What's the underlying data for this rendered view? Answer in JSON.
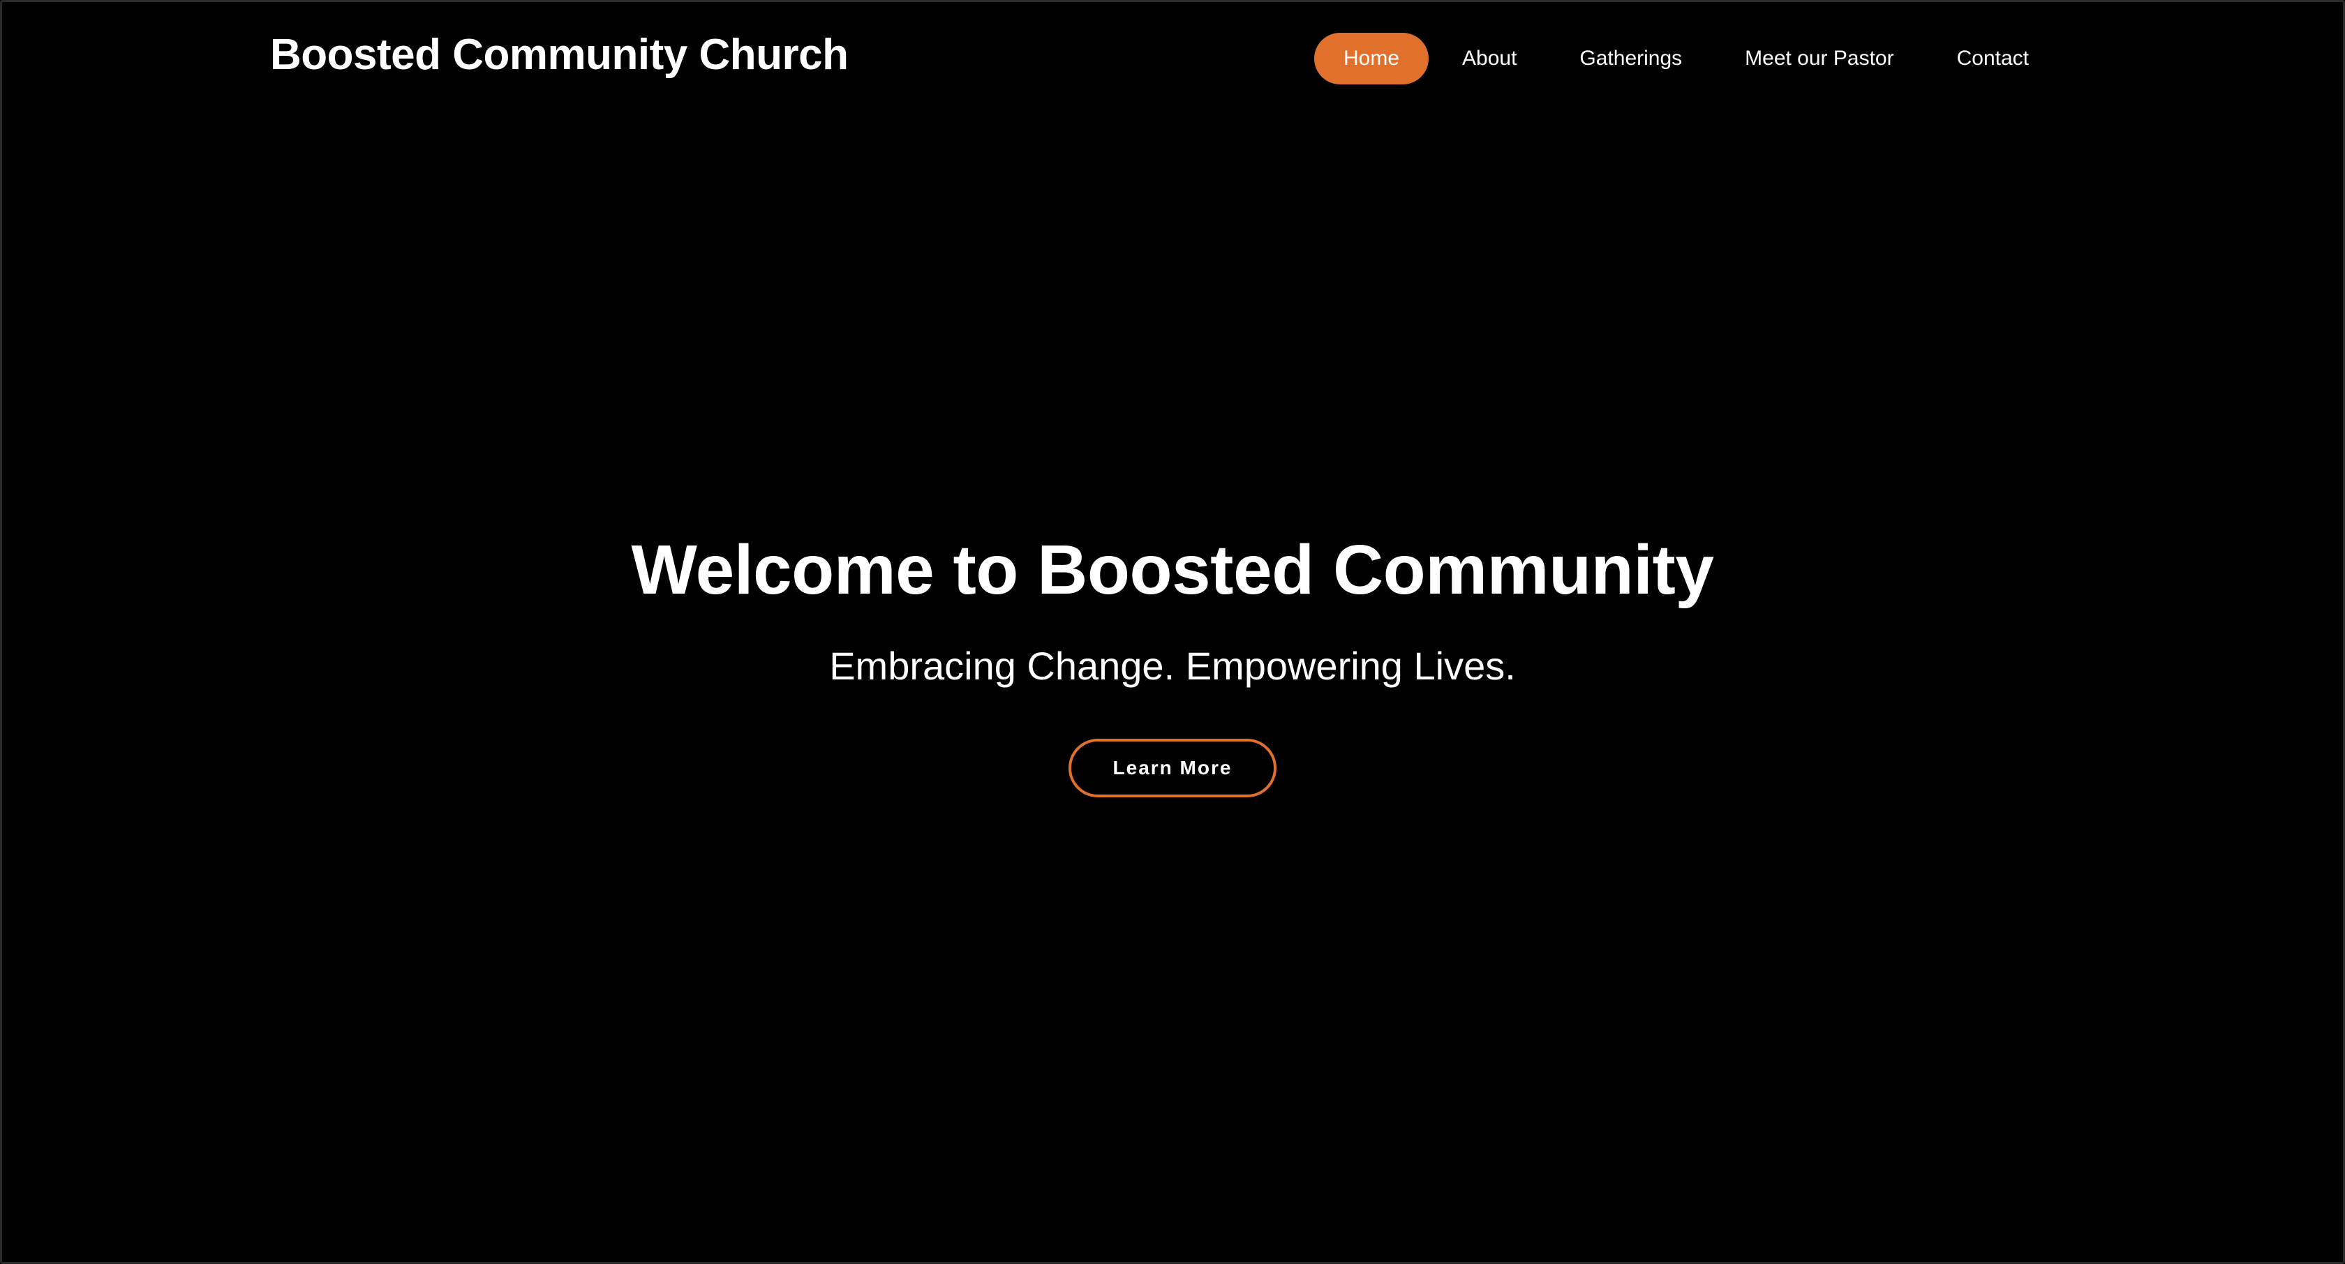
{
  "header": {
    "brand": "Boosted Community Church",
    "nav": [
      {
        "label": "Home",
        "active": true
      },
      {
        "label": "About",
        "active": false
      },
      {
        "label": "Gatherings",
        "active": false
      },
      {
        "label": "Meet our Pastor",
        "active": false
      },
      {
        "label": "Contact",
        "active": false
      }
    ]
  },
  "hero": {
    "title": "Welcome to Boosted Community",
    "subtitle": "Embracing Change. Empowering Lives.",
    "cta_label": "Learn More"
  },
  "colors": {
    "background": "#000000",
    "accent": "#e1702d",
    "text": "#ffffff"
  }
}
